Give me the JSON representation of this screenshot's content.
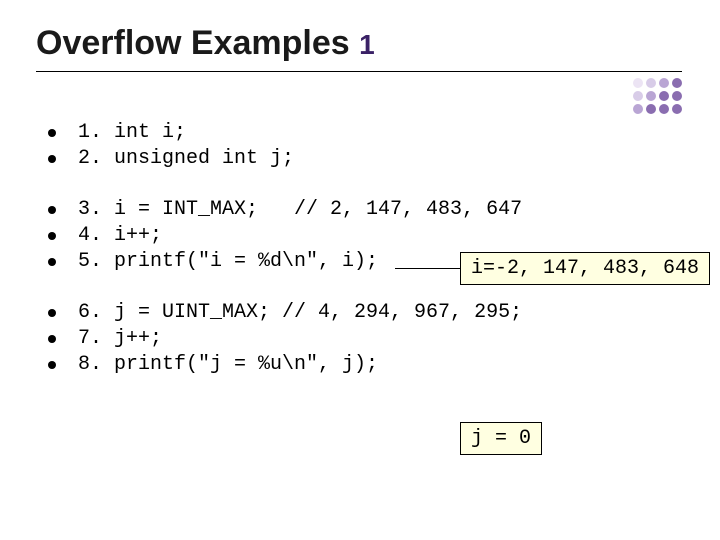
{
  "title": {
    "main": "Overflow Examples",
    "suffix": "1"
  },
  "groups": [
    {
      "lines": [
        "1. int i;",
        "2. unsigned int j;"
      ]
    },
    {
      "lines": [
        "3. i = INT_MAX;   // 2, 147, 483, 647",
        "4. i++;",
        "5. printf(\"i = %d\\n\", i);"
      ]
    },
    {
      "lines": [
        "6. j = UINT_MAX; // 4, 294, 967, 295;",
        "7. j++;",
        "8. printf(\"j = %u\\n\", j);"
      ]
    }
  ],
  "callouts": [
    {
      "text": "i=-2, 147, 483, 648"
    },
    {
      "text": "j = 0"
    }
  ]
}
